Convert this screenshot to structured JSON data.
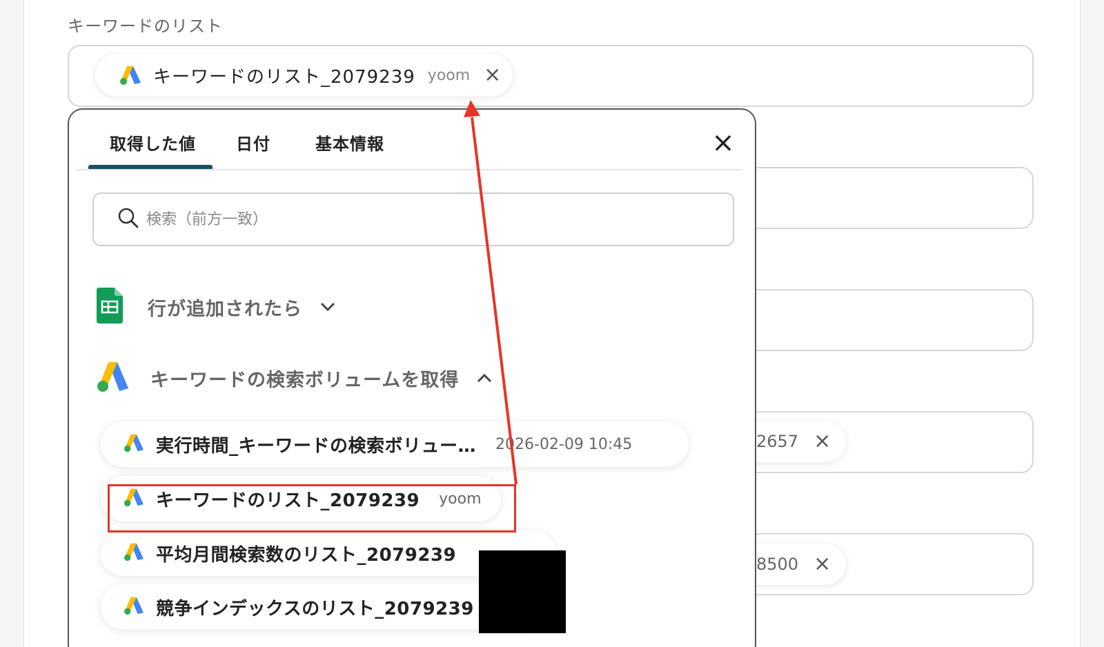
{
  "field": {
    "label": "キーワードのリスト",
    "chip_label": "キーワードのリスト_2079239",
    "chip_sub": "yoom",
    "remove_icon": "×"
  },
  "background_chips": [
    {
      "value": "2657",
      "remove_icon": "×"
    },
    {
      "value": "8500",
      "remove_icon": "×"
    }
  ],
  "popup": {
    "tabs": [
      {
        "label": "取得した値",
        "active": true
      },
      {
        "label": "日付",
        "active": false
      },
      {
        "label": "基本情報",
        "active": false
      }
    ],
    "close_icon": "×",
    "search": {
      "placeholder": "検索（前方一致）",
      "value": ""
    },
    "groups": [
      {
        "title": "行が追加されたら",
        "icon": "google-sheets-icon",
        "expanded": false,
        "chevron": "⌄"
      },
      {
        "title": "キーワードの検索ボリュームを取得",
        "icon": "google-ads-icon",
        "expanded": true,
        "chevron": "⌃"
      }
    ],
    "items": [
      {
        "label": "実行時間_キーワードの検索ボリュー…",
        "value": "2026-02-09 10:45"
      },
      {
        "label": "キーワードのリスト_2079239",
        "value": "yoom",
        "highlighted": true
      },
      {
        "label": "平均月間検索数のリスト_2079239",
        "value": ""
      },
      {
        "label": "競争インデックスのリスト_2079239",
        "value": ""
      }
    ]
  },
  "colors": {
    "accent": "#1b4f63",
    "highlight": "#e53526",
    "ads_yellow": "#fbbc04",
    "ads_blue": "#4285f4",
    "ads_green": "#34a853",
    "sheets_green": "#0f9d58"
  }
}
